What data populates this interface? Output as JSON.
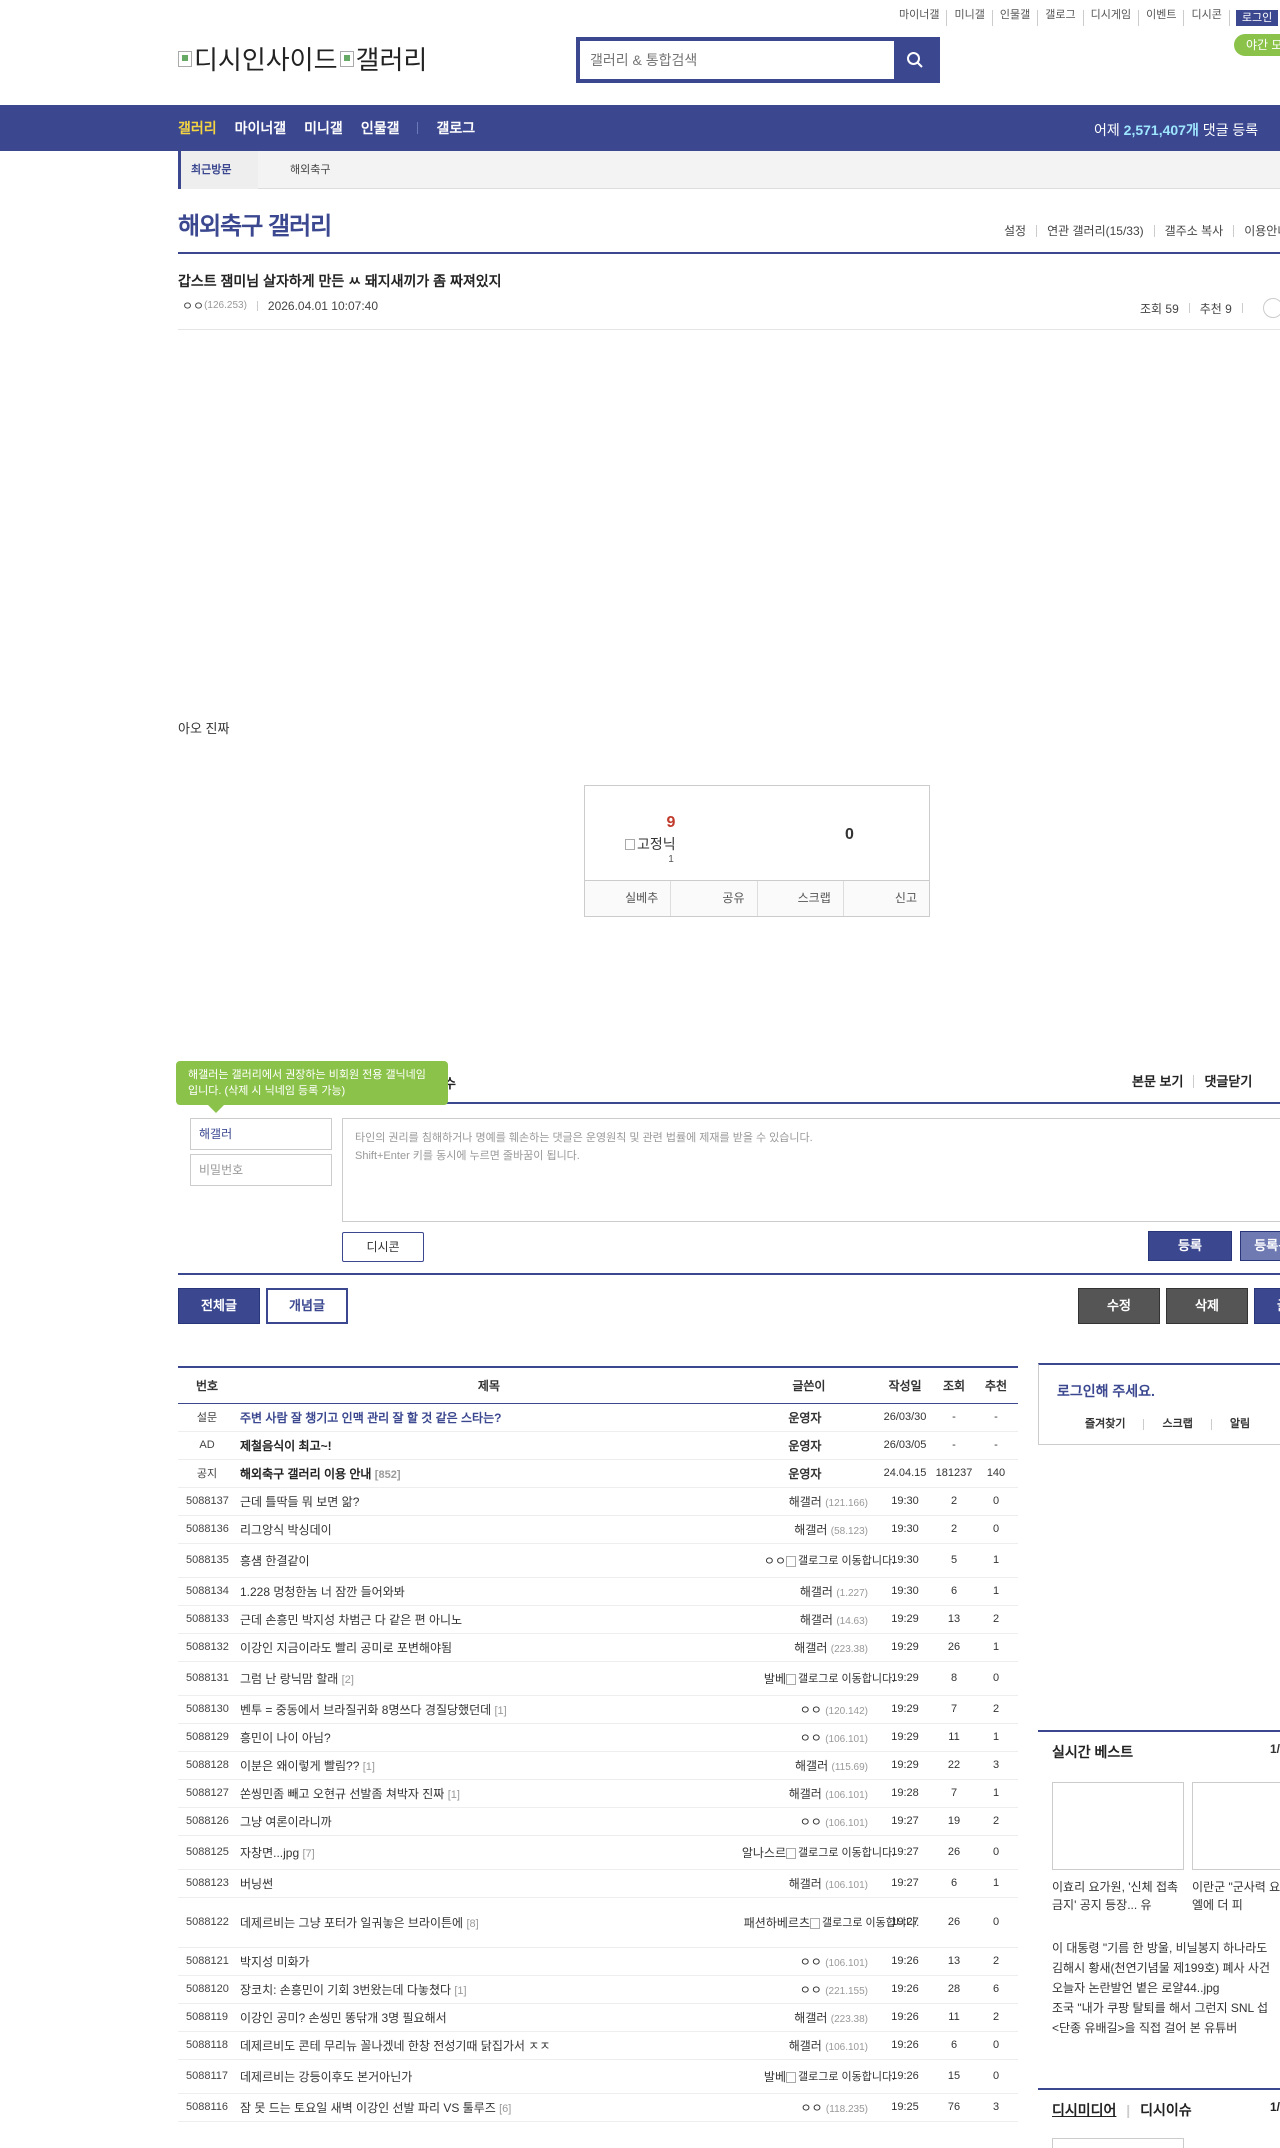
{
  "util": {
    "links": [
      "마이너갤",
      "미니갤",
      "인물갤",
      "갤로그",
      "디시게임",
      "이벤트",
      "디시콘"
    ],
    "login": "로그인",
    "night": "야간 모드"
  },
  "logo": {
    "alt1": "디시인사이드",
    "alt2": "갤러리"
  },
  "search": {
    "placeholder": "갤러리 & 통합검색"
  },
  "gnb": {
    "items": [
      "갤러리",
      "마이너갤",
      "미니갤",
      "인물갤",
      "갤로그"
    ],
    "count_prefix": "어제 ",
    "count_value": "2,571,407개",
    "count_suffix": " 댓글 등록"
  },
  "lnb": {
    "recent": "최근방문",
    "item": "해외축구"
  },
  "gallery": {
    "title": "해외축구 갤러리",
    "options": [
      "설정",
      "연관 갤러리(15/33)",
      "갤주소 복사",
      "이용안내"
    ]
  },
  "post": {
    "title": "갑스트 잼미님 살자하게 만든 ㅆ 돼지새끼가 좀 짜져있지",
    "author": "ㅇㅇ",
    "ip": "(126.253)",
    "date": "2026.04.01 10:07:40",
    "views_label": "조회 59",
    "rec_label": "추천 9",
    "body": "아오 진짜"
  },
  "recommend": {
    "up": "9",
    "fixed_label": "고정닉",
    "fixed_count": "1",
    "down": "0",
    "buttons": [
      "실베추",
      "공유",
      "스크랩",
      "신고"
    ]
  },
  "comment": {
    "tooltip": "해갤러는 갤러리에서 권장하는 비회원 전용 갤닉네임입니다. (삭제 시 닉네임 등록 가능)",
    "head_frag": "수",
    "head_right": [
      "본문 보기",
      "댓글닫기"
    ],
    "nick": "해갤러",
    "pw_placeholder": "비밀번호",
    "notice1": "타인의 권리를 침해하거나 명예를 훼손하는 댓글은 운영원칙 및 관련 법률에 제재를 받을 수 있습니다.",
    "notice2": "Shift+Enter 키를 동시에 누르면 줄바꿈이 됩니다.",
    "dccon": "디시콘",
    "submit": "등록",
    "submit2": "등록+추천"
  },
  "actions": {
    "all": "전체글",
    "concept": "개념글",
    "edit": "수정",
    "delete": "삭제",
    "write": "글쓰기"
  },
  "list": {
    "headers": [
      "번호",
      "제목",
      "글쓴이",
      "작성일",
      "조회",
      "추천"
    ],
    "rows": [
      {
        "num": "설문",
        "title": "주변 사람 잘 챙기고 인맥 관리 잘 할 것 같은 스타는?",
        "reply": "",
        "writer": "운영자",
        "ip": "",
        "date": "26/03/30",
        "views": "-",
        "rec": "-",
        "type": "survey"
      },
      {
        "num": "AD",
        "title": "제철음식이 최고~!",
        "reply": "",
        "writer": "운영자",
        "ip": "",
        "date": "26/03/05",
        "views": "-",
        "rec": "-",
        "type": "notice"
      },
      {
        "num": "공지",
        "title": "해외축구 갤러리 이용 안내",
        "reply": "[852]",
        "writer": "운영자",
        "ip": "",
        "date": "24.04.15",
        "views": "181237",
        "rec": "140",
        "type": "notice"
      },
      {
        "num": "5088137",
        "title": "근데 틀딱들 뭐 보면 앎?",
        "reply": "",
        "writer": "해갤러",
        "ip": "(121.166)",
        "date": "19:30",
        "views": "2",
        "rec": "0",
        "type": "normal"
      },
      {
        "num": "5088136",
        "title": "리그앙식 박싱데이",
        "reply": "",
        "writer": "해갤러",
        "ip": "(58.123)",
        "date": "19:30",
        "views": "2",
        "rec": "0",
        "type": "normal"
      },
      {
        "num": "5088135",
        "title": "흥섐 한결같이",
        "reply": "",
        "writer": "ㅇㅇ",
        "ip": "",
        "gallog": "갤로그로 이동합니다.",
        "date": "19:30",
        "views": "5",
        "rec": "1",
        "type": "gallog"
      },
      {
        "num": "5088134",
        "title": "1.228 멍청한놈 너 잠깐 들어와봐",
        "reply": "",
        "writer": "해갤러",
        "ip": "(1.227)",
        "date": "19:30",
        "views": "6",
        "rec": "1",
        "type": "normal"
      },
      {
        "num": "5088133",
        "title": "근데 손흥민 박지성 차범근 다 같은 편 아니노",
        "reply": "",
        "writer": "해갤러",
        "ip": "(14.63)",
        "date": "19:29",
        "views": "13",
        "rec": "2",
        "type": "normal"
      },
      {
        "num": "5088132",
        "title": "이강인 지금이라도 빨리 공미로 포변해야됨",
        "reply": "",
        "writer": "해갤러",
        "ip": "(223.38)",
        "date": "19:29",
        "views": "26",
        "rec": "1",
        "type": "normal"
      },
      {
        "num": "5088131",
        "title": "그럼 난 랑닉맘 할래",
        "reply": "[2]",
        "writer": "발베",
        "ip": "",
        "gallog": "갤로그로 이동합니다.",
        "date": "19:29",
        "views": "8",
        "rec": "0",
        "type": "gallog"
      },
      {
        "num": "5088130",
        "title": "벤투 = 중동에서 브라질귀화 8명쓰다 경질당했던데",
        "reply": "[1]",
        "writer": "ㅇㅇ",
        "ip": "(120.142)",
        "date": "19:29",
        "views": "7",
        "rec": "2",
        "type": "normal"
      },
      {
        "num": "5088129",
        "title": "흥민이 나이 아님?",
        "reply": "",
        "writer": "ㅇㅇ",
        "ip": "(106.101)",
        "date": "19:29",
        "views": "11",
        "rec": "1",
        "type": "normal"
      },
      {
        "num": "5088128",
        "title": "이분은 왜이렇게 빨림??",
        "reply": "[1]",
        "writer": "해갤러",
        "ip": "(115.69)",
        "date": "19:29",
        "views": "22",
        "rec": "3",
        "type": "normal"
      },
      {
        "num": "5088127",
        "title": "쏜씽민좀 빼고 오현규 선발좀 쳐박자 진짜",
        "reply": "[1]",
        "writer": "해갤러",
        "ip": "(106.101)",
        "date": "19:28",
        "views": "7",
        "rec": "1",
        "type": "normal"
      },
      {
        "num": "5088126",
        "title": "그냥 여론이라니까",
        "reply": "",
        "writer": "ㅇㅇ",
        "ip": "(106.101)",
        "date": "19:27",
        "views": "19",
        "rec": "2",
        "type": "normal"
      },
      {
        "num": "5088125",
        "title": "자창면...jpg",
        "reply": "[7]",
        "writer": "알나스르",
        "ip": "",
        "gallog": "갤로그로 이동합니다.",
        "date": "19:27",
        "views": "26",
        "rec": "0",
        "type": "gallog"
      },
      {
        "num": "5088123",
        "title": "버닝썬",
        "reply": "",
        "writer": "해갤러",
        "ip": "(106.101)",
        "date": "19:27",
        "views": "6",
        "rec": "1",
        "type": "normal"
      },
      {
        "num": "5088122",
        "title": "데제르비는 그냥 포터가 일궈놓은 브라이튼에",
        "reply": "[8]",
        "writer": "패션하베르츠",
        "ip": "",
        "gallog": "갤로그로 이동합니다.",
        "date": "19:27",
        "views": "26",
        "rec": "0",
        "type": "gallog3"
      },
      {
        "num": "5088121",
        "title": "박지성 미화가",
        "reply": "",
        "writer": "ㅇㅇ",
        "ip": "(106.101)",
        "date": "19:26",
        "views": "13",
        "rec": "2",
        "type": "normal"
      },
      {
        "num": "5088120",
        "title": "장코치: 손흥민이 기회 3번왔는데 다놓쳤다",
        "reply": "[1]",
        "writer": "ㅇㅇ",
        "ip": "(221.155)",
        "date": "19:26",
        "views": "28",
        "rec": "6",
        "type": "normal"
      },
      {
        "num": "5088119",
        "title": "이강인 공미? 손씽민 똥닦개 3명 필요해서",
        "reply": "",
        "writer": "해갤러",
        "ip": "(223.38)",
        "date": "19:26",
        "views": "11",
        "rec": "2",
        "type": "normal"
      },
      {
        "num": "5088118",
        "title": "데제르비도 콘테 무리뉴 꼴나겠네 한창 전성기때 닭집가서 ㅈㅈ",
        "reply": "",
        "writer": "해갤러",
        "ip": "(106.101)",
        "date": "19:26",
        "views": "6",
        "rec": "0",
        "type": "normal"
      },
      {
        "num": "5088117",
        "title": "데제르비는 강등이후도 본거아닌가",
        "reply": "",
        "writer": "발베",
        "ip": "",
        "gallog": "갤로그로 이동합니다.",
        "date": "19:26",
        "views": "15",
        "rec": "0",
        "type": "gallog"
      },
      {
        "num": "5088116",
        "title": "잠 못 드는 토요일 새벽 이강인 선발 파리 VS 툴루즈",
        "reply": "[6]",
        "writer": "ㅇㅇ",
        "ip": "(118.235)",
        "date": "19:25",
        "views": "76",
        "rec": "3",
        "type": "normal"
      }
    ]
  },
  "side": {
    "login_title": "로그인해 주세요.",
    "login_links": [
      "즐겨찾기",
      "스크랩",
      "알림"
    ],
    "best_title": "실시간 베스트",
    "best_page": "1/",
    "thumb_caps": [
      "이효리 요가원, '신체 접촉 금지' 공지 등장... 유",
      "이란군 \"군사력 요 이스라엘에 더 피"
    ],
    "best_list": [
      "이 대통령 \"기름 한 방울, 비닐봉지 하나라도",
      "김해시 황새(천연기념물 제199호) 폐사 사건",
      "오늘자 논란발언 볕은 로얄44..jpg",
      "조국 \"내가 쿠팡 탈퇴를 해서 그런지 SNL 섭",
      "<단종 유배길>을 직접 걸어 본 유튜버"
    ],
    "media_tabs": [
      "디시미디어",
      "디시이슈"
    ],
    "media_page": "1/"
  },
  "colors": {
    "brand": "#3b4890",
    "accent_green": "#8bc34a",
    "highlight": "#f5d442"
  }
}
